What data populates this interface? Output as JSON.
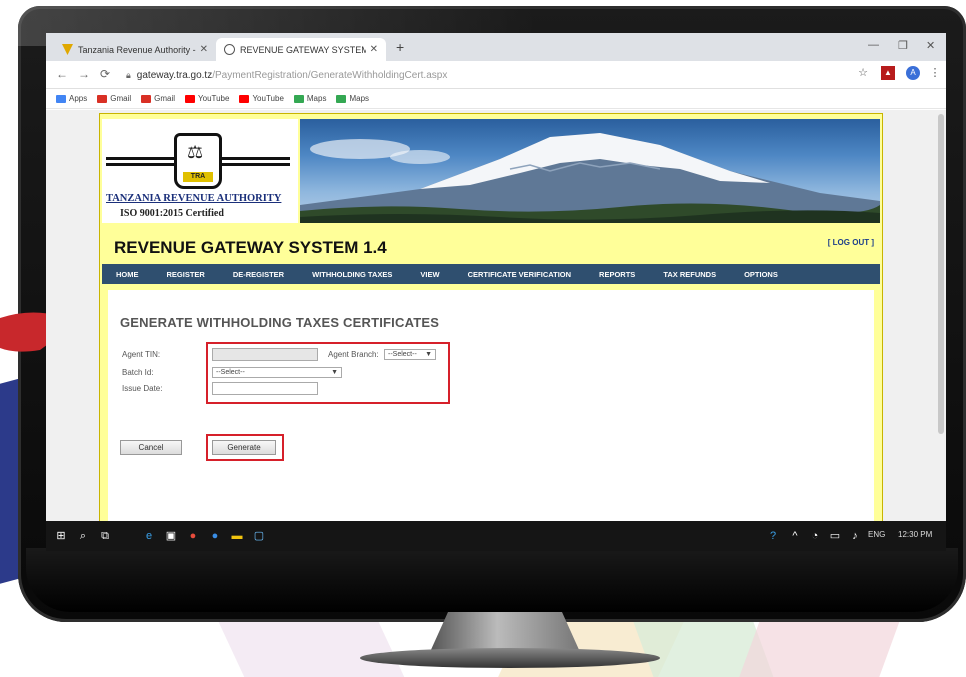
{
  "browser": {
    "tabs": [
      {
        "title": "Tanzania Revenue Authority - H",
        "active": false
      },
      {
        "title": "REVENUE GATEWAY SYSTEM",
        "active": true
      }
    ],
    "url_host": "gateway.tra.go.tz",
    "url_path": "/PaymentRegistration/GenerateWithholdingCert.aspx",
    "bookmarks": [
      {
        "label": "Apps",
        "icon": "apps-grid-icon",
        "color": "#4285f4"
      },
      {
        "label": "Gmail",
        "icon": "gmail-icon",
        "color": "#d93025"
      },
      {
        "label": "Gmail",
        "icon": "gmail-icon",
        "color": "#d93025"
      },
      {
        "label": "YouTube",
        "icon": "youtube-icon",
        "color": "#ff0000"
      },
      {
        "label": "YouTube",
        "icon": "youtube-icon",
        "color": "#ff0000"
      },
      {
        "label": "Maps",
        "icon": "maps-icon",
        "color": "#34a853"
      },
      {
        "label": "Maps",
        "icon": "maps-icon",
        "color": "#34a853"
      }
    ],
    "profile_initial": "A"
  },
  "site": {
    "org_name": "TANZANIA REVENUE AUTHORITY",
    "iso": "ISO 9001:2015 Certified",
    "emblem_text": "TRA",
    "system_title": "REVENUE GATEWAY SYSTEM 1.4",
    "logout": "[ LOG OUT ]",
    "menu": [
      "HOME",
      "REGISTER",
      "DE-REGISTER",
      "WITHHOLDING TAXES",
      "VIEW",
      "CERTIFICATE VERIFICATION",
      "REPORTS",
      "TAX REFUNDS",
      "OPTIONS"
    ]
  },
  "form": {
    "title": "GENERATE WITHHOLDING TAXES CERTIFICATES",
    "agent_tin_label": "Agent TIN:",
    "agent_branch_label": "Agent Branch:",
    "agent_branch_value": "--Select--",
    "batch_label": "Batch Id:",
    "batch_value": "--Select--",
    "issue_date_label": "Issue Date:",
    "cancel": "Cancel",
    "generate": "Generate"
  },
  "taskbar": {
    "lang": "ENG",
    "time": "12:30 PM"
  },
  "colors": {
    "site_bg": "#ffff99",
    "menu_bg": "#2f4f6f",
    "highlight": "#d6202a"
  }
}
